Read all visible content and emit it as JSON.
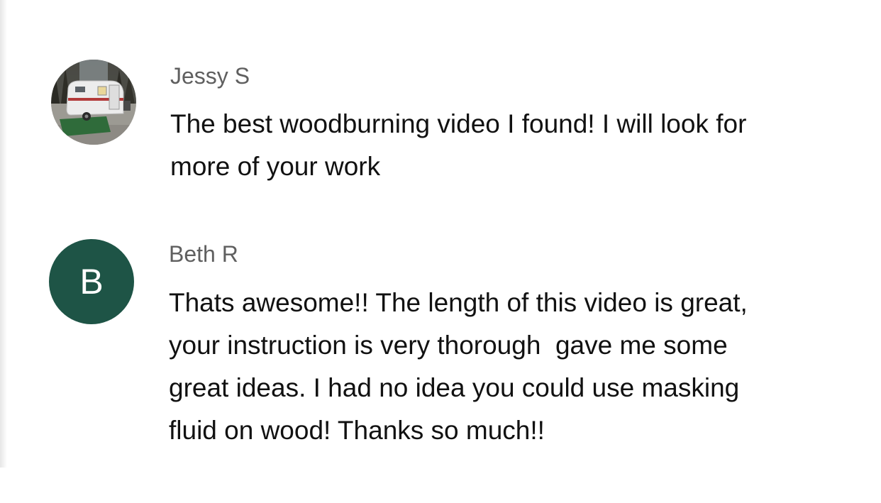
{
  "comments": [
    {
      "author": "Jessy S",
      "avatar_type": "photo",
      "avatar_description_icon": "trailer-photo-icon",
      "lines": [
        "The best woodburning video I found! I will look for",
        "more of your work"
      ]
    },
    {
      "author": "Beth R",
      "avatar_type": "letter",
      "avatar_letter": "B",
      "avatar_color": "#1e5446",
      "lines": [
        "Thats awesome!! The length of this video is great,",
        "your instruction is very thorough  gave me some",
        "great ideas. I had no idea you could use masking",
        "fluid on wood! Thanks so much!!"
      ]
    }
  ],
  "colors": {
    "author_text": "#5f5f5f",
    "body_text": "#111111",
    "background": "#ffffff"
  }
}
